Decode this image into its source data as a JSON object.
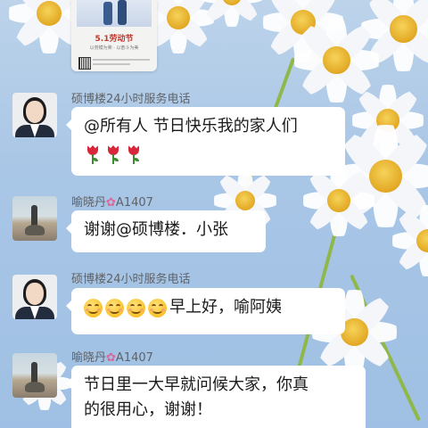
{
  "poster": {
    "title": "5.1劳动节",
    "subtitle": "以劳模为荣 · 以奋斗为美"
  },
  "messages": [
    {
      "sender": "硕博楼24小时服务电话",
      "text": "@所有人 节日快乐我的家人们",
      "emoji_count": 3,
      "emoji_icon": "tulip-icon"
    },
    {
      "sender_name": "喻晓丹",
      "sender_flower_icon": "cherry-blossom-icon",
      "sender_unit": "A1407",
      "text": "谢谢@硕博楼．小张"
    },
    {
      "sender": "硕博楼24小时服务电话",
      "emoji_count": 4,
      "emoji_icon": "smiling-face-icon",
      "text": "早上好，喻阿姨"
    },
    {
      "sender_name": "喻晓丹",
      "sender_flower_icon": "cherry-blossom-icon",
      "sender_unit": "A1407",
      "text_line1": "节日里一大早就问候大家，你真",
      "text_line2": "的很用心，谢谢！"
    }
  ],
  "colors": {
    "wallpaper": "#a9c6e6",
    "bubble": "#ffffff",
    "sender_text": "#5f6368",
    "message_text": "#1a1a1a",
    "tulip": "#d8263a",
    "poster_title": "#c8352a"
  }
}
